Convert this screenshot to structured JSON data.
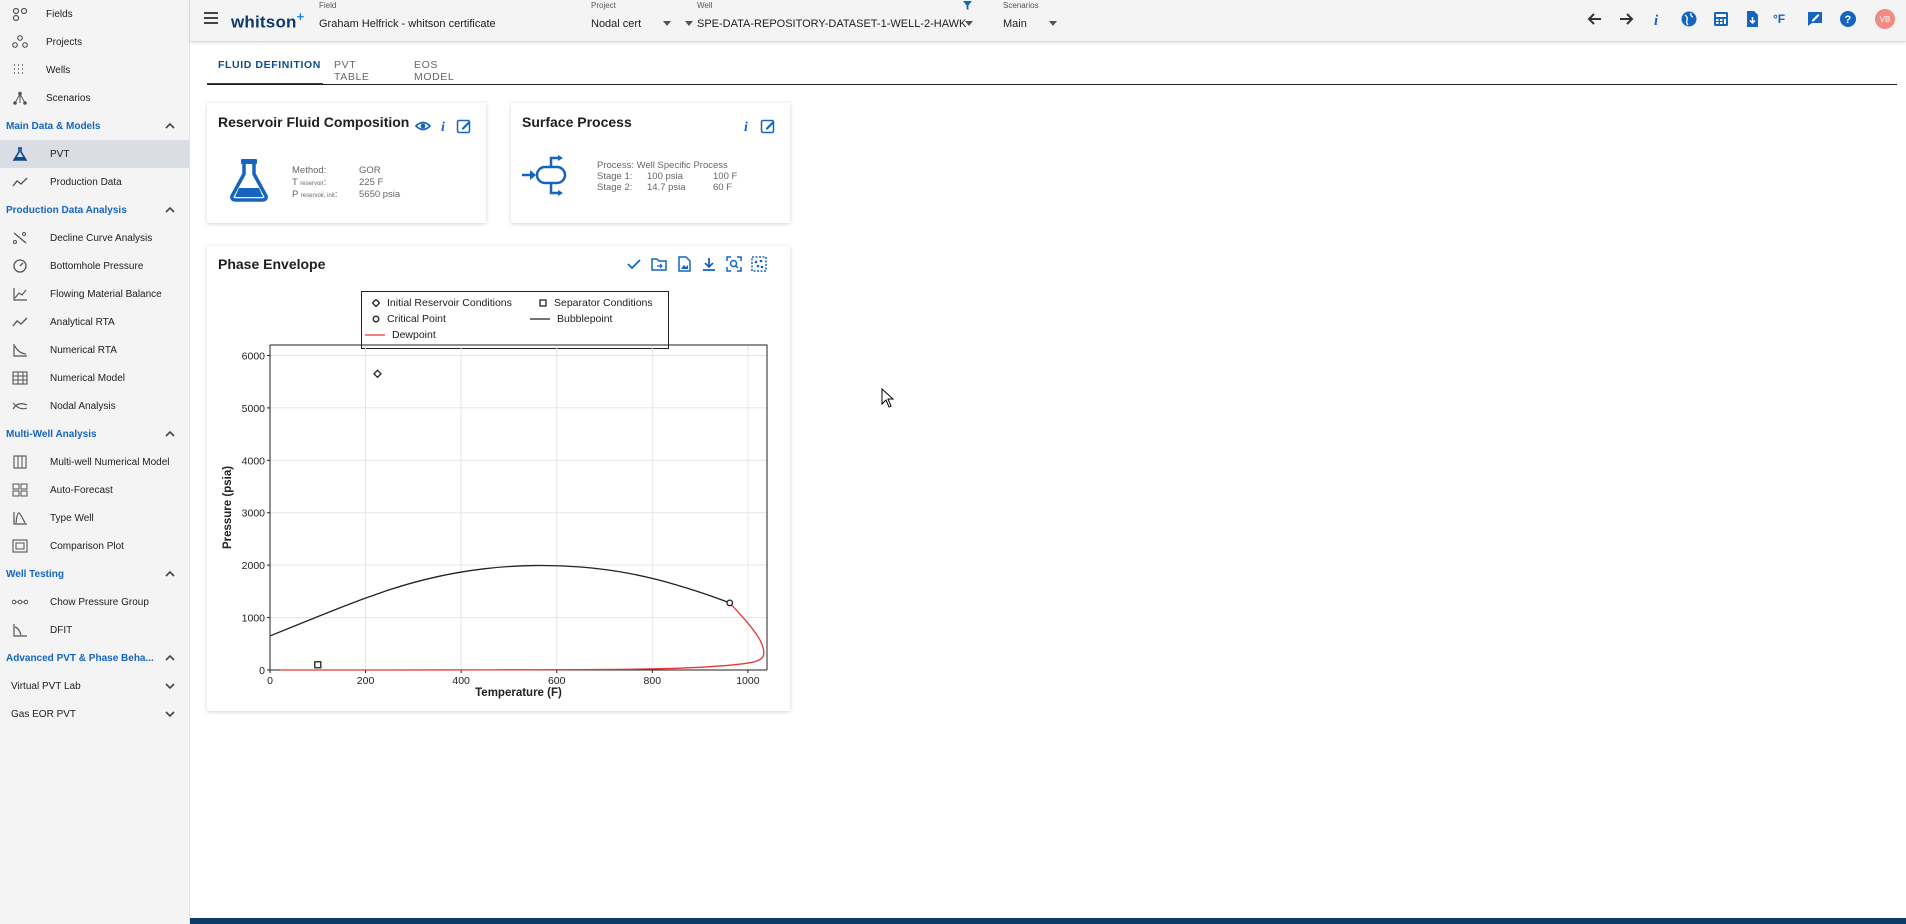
{
  "sidebar": {
    "top_items": [
      {
        "label": "Fields",
        "icon": "fields-icon"
      },
      {
        "label": "Projects",
        "icon": "projects-icon"
      },
      {
        "label": "Wells",
        "icon": "wells-icon"
      },
      {
        "label": "Scenarios",
        "icon": "scenarios-icon"
      }
    ],
    "sections": [
      {
        "title": "Main Data & Models",
        "items": [
          {
            "label": "PVT",
            "icon": "flask-icon",
            "active": true
          },
          {
            "label": "Production Data",
            "icon": "trend-icon"
          }
        ]
      },
      {
        "title": "Production Data Analysis",
        "items": [
          {
            "label": "Decline Curve Analysis",
            "icon": "decline-icon"
          },
          {
            "label": "Bottomhole Pressure",
            "icon": "gauge-icon"
          },
          {
            "label": "Flowing Material Balance",
            "icon": "fmb-icon"
          },
          {
            "label": "Analytical RTA",
            "icon": "trend-icon"
          },
          {
            "label": "Numerical RTA",
            "icon": "numrta-icon"
          },
          {
            "label": "Numerical Model",
            "icon": "grid-icon"
          },
          {
            "label": "Nodal Analysis",
            "icon": "nodal-icon"
          }
        ]
      },
      {
        "title": "Multi-Well Analysis",
        "items": [
          {
            "label": "Multi-well Numerical Model",
            "icon": "multiwell-icon"
          },
          {
            "label": "Auto-Forecast",
            "icon": "autoforecast-icon"
          },
          {
            "label": "Type Well",
            "icon": "typewell-icon"
          },
          {
            "label": "Comparison Plot",
            "icon": "comparison-icon"
          }
        ]
      },
      {
        "title": "Well Testing",
        "items": [
          {
            "label": "Chow Pressure Group",
            "icon": "chow-icon"
          },
          {
            "label": "DFIT",
            "icon": "dfit-icon"
          }
        ]
      },
      {
        "title": "Advanced PVT & Phase Beha...",
        "items": []
      }
    ],
    "collapsed": [
      "Virtual PVT Lab",
      "Gas EOR PVT"
    ]
  },
  "topbar": {
    "logo": "whitson",
    "logo_plus": "+",
    "field_caption": "Field",
    "field_value": "Graham Helfrick - whitson certificate",
    "project_caption": "Project",
    "project_value": "Nodal cert",
    "well_caption": "Well",
    "well_value": "SPE-DATA-REPOSITORY-DATASET-1-WELL-2-HAWK",
    "scenarios_caption": "Scenarios",
    "scenarios_value": "Main",
    "avatar_initials": "VB",
    "unit_label": "°F"
  },
  "tabs": [
    "FLUID DEFINITION",
    "PVT TABLE",
    "EOS MODEL"
  ],
  "reservoir_card": {
    "title": "Reservoir Fluid Composition",
    "method_label": "Method:",
    "method_value": "GOR",
    "t_label": "T",
    "t_sub": "reservoir",
    "t_suffix": ":",
    "t_value": "225 F",
    "p_label": "P",
    "p_sub": "reservoir, init",
    "p_suffix": ":",
    "p_value": "5650 psia"
  },
  "surface_card": {
    "title": "Surface Process",
    "process_line": "Process: Well Specific Process",
    "stage1_label": "Stage 1:",
    "stage1_p": "100 psia",
    "stage1_t": "100 F",
    "stage2_label": "Stage 2:",
    "stage2_p": "14.7 psia",
    "stage2_t": "60 F"
  },
  "phase_card": {
    "title": "Phase Envelope"
  },
  "chart_data": {
    "type": "line",
    "xlabel": "Temperature (F)",
    "ylabel": "Pressure (psia)",
    "xlim": [
      0,
      1040
    ],
    "ylim": [
      0,
      6200
    ],
    "xticks": [
      0,
      200,
      400,
      600,
      800,
      1000
    ],
    "yticks": [
      0,
      1000,
      2000,
      3000,
      4000,
      5000,
      6000
    ],
    "grid": true,
    "legend_position": "top",
    "legend": [
      "Initial Reservoir Conditions",
      "Separator Conditions",
      "Critical Point",
      "Bubblepoint",
      "Dewpoint"
    ],
    "colors": {
      "bubblepoint": "#222222",
      "dewpoint": "#e53935"
    },
    "series": [
      {
        "name": "Bubblepoint",
        "x": [
          0,
          100,
          200,
          300,
          400,
          500,
          600,
          700,
          800,
          900,
          962
        ],
        "y": [
          650,
          1020,
          1380,
          1680,
          1880,
          1985,
          2000,
          1930,
          1760,
          1490,
          1280
        ]
      },
      {
        "name": "Dewpoint",
        "x": [
          962,
          1000,
          1025,
          1035,
          1030,
          1000,
          900,
          800,
          700,
          600,
          500,
          400,
          300,
          200,
          100,
          20
        ],
        "y": [
          1280,
          900,
          600,
          350,
          200,
          120,
          45,
          20,
          10,
          5,
          3,
          2,
          1,
          0,
          0,
          0
        ]
      },
      {
        "name": "Initial Reservoir Conditions",
        "x": [
          225
        ],
        "y": [
          5650
        ]
      },
      {
        "name": "Separator Conditions",
        "x": [
          100
        ],
        "y": [
          100
        ]
      },
      {
        "name": "Critical Point",
        "x": [
          962
        ],
        "y": [
          1280
        ]
      }
    ]
  }
}
